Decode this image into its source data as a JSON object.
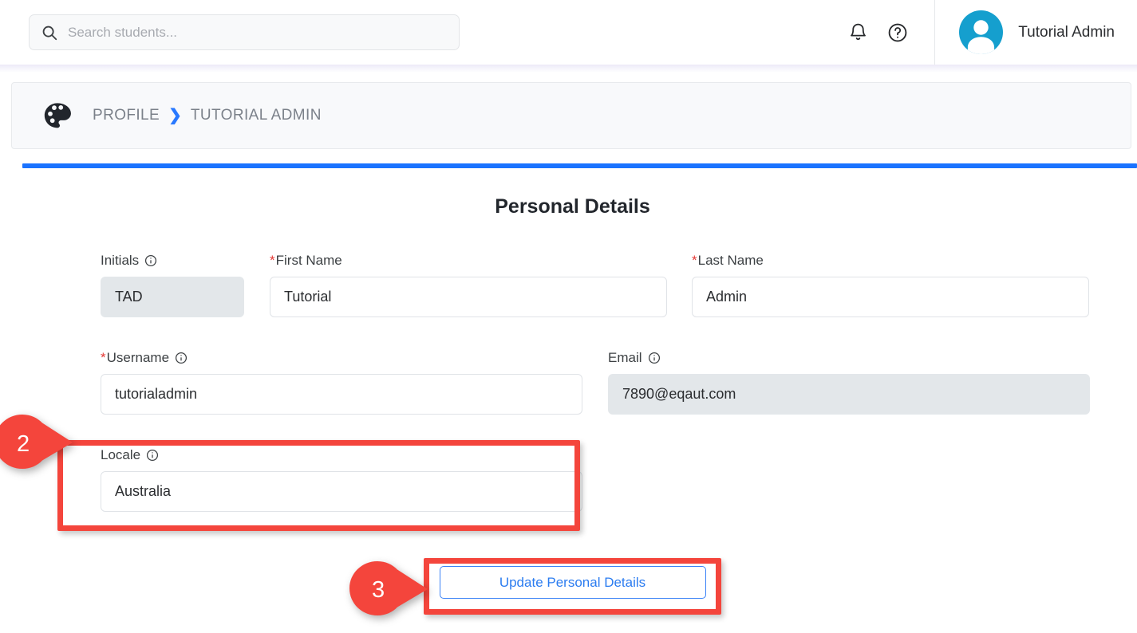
{
  "header": {
    "search": {
      "placeholder": "Search students...",
      "value": "",
      "icon": "search-icon"
    },
    "notifications_icon": "bell-icon",
    "help_icon": "help-circle-icon",
    "user": {
      "name": "Tutorial Admin",
      "avatar_icon": "user-avatar-icon",
      "avatar_color": "#159fce"
    }
  },
  "breadcrumb": {
    "icon": "palette-icon",
    "root": "PROFILE",
    "separator": "❯",
    "current": "TUTORIAL ADMIN",
    "separator_color": "#2979ff"
  },
  "card": {
    "accent_color": "#1a73ff",
    "title": "Personal Details",
    "fields": {
      "initials": {
        "label": "Initials",
        "value": "TAD",
        "required": false,
        "disabled": true,
        "info_icon": "info-icon"
      },
      "first_name": {
        "label": "First Name",
        "value": "Tutorial",
        "required": true,
        "disabled": false
      },
      "last_name": {
        "label": "Last Name",
        "value": "Admin",
        "required": true,
        "disabled": false
      },
      "username": {
        "label": "Username",
        "value": "tutorialadmin",
        "required": true,
        "disabled": false,
        "info_icon": "info-icon"
      },
      "email": {
        "label": "Email",
        "value": "7890@eqaut.com",
        "required": false,
        "disabled": true,
        "info_icon": "info-icon"
      },
      "locale": {
        "label": "Locale",
        "value": "Australia",
        "required": false,
        "disabled": false,
        "info_icon": "info-icon"
      }
    },
    "submit_button": {
      "label": "Update Personal Details",
      "color": "#2b7cf0"
    }
  },
  "annotations": {
    "color": "#f4453c",
    "callouts": [
      {
        "number": "2",
        "target": "locale-field-group"
      },
      {
        "number": "3",
        "target": "update-personal-details-button"
      }
    ]
  }
}
